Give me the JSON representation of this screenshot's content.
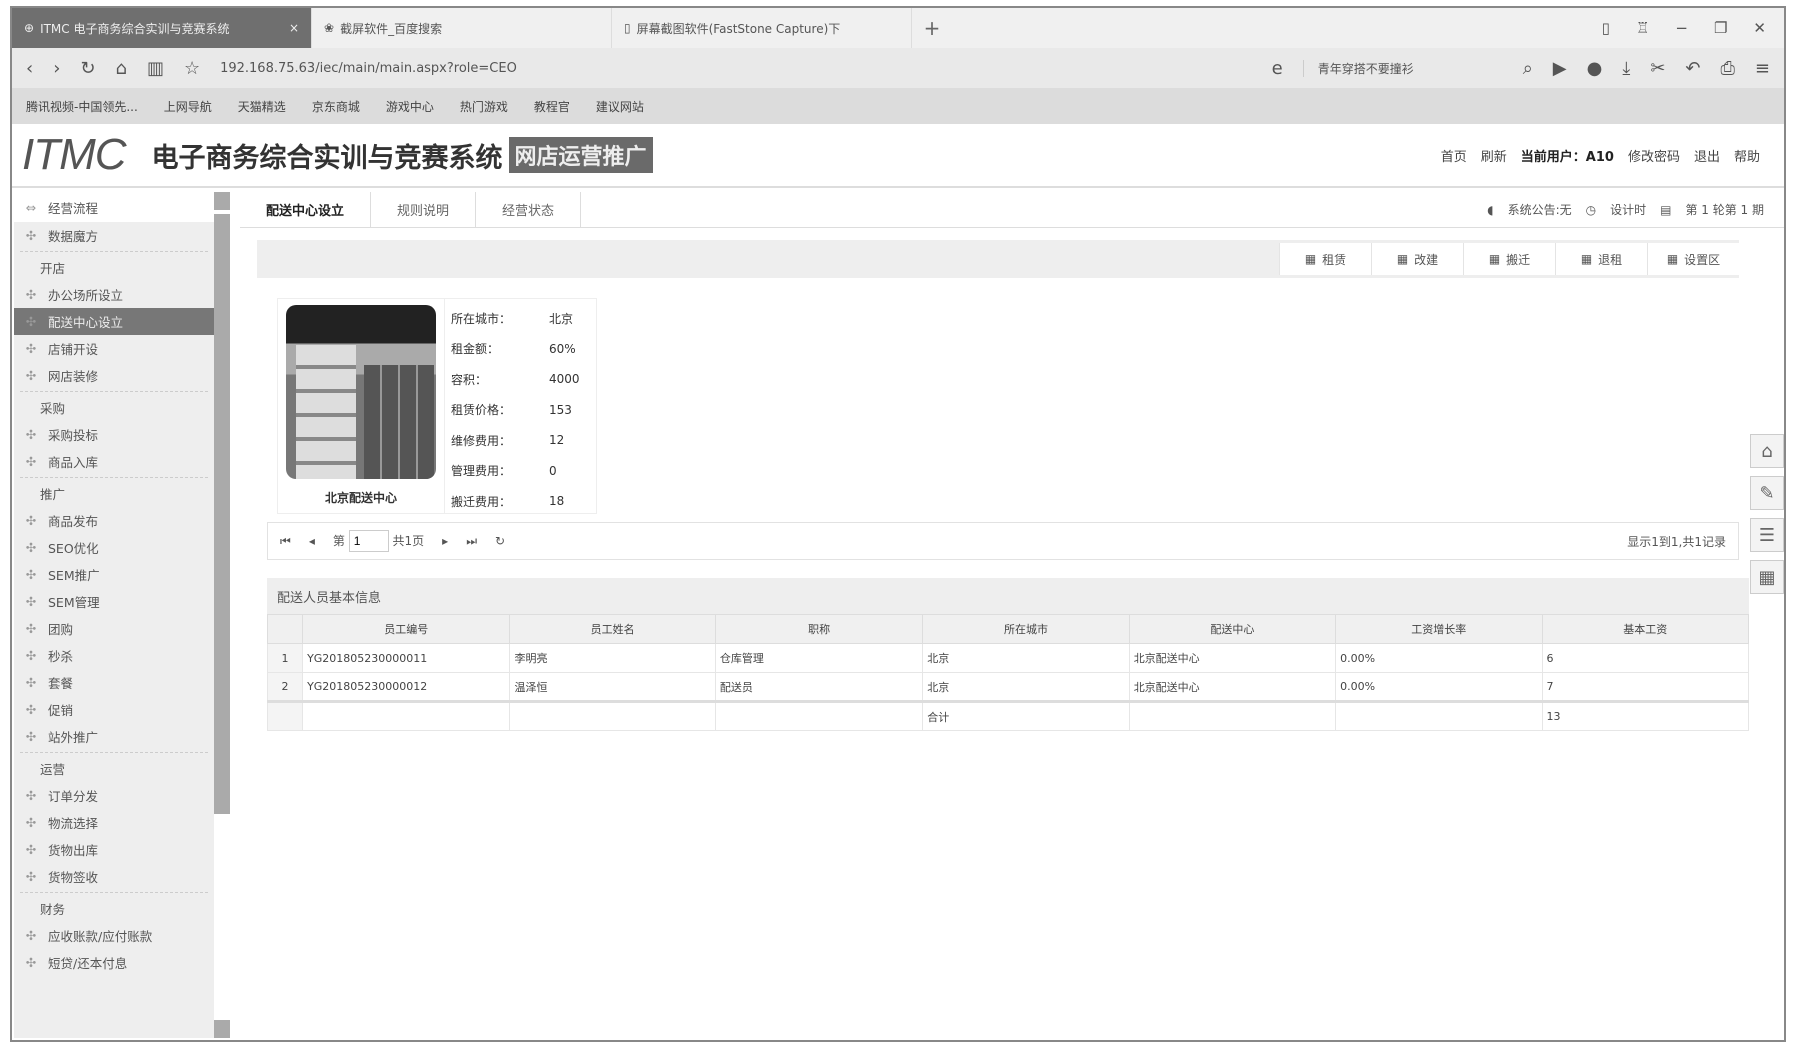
{
  "browser": {
    "tabs": [
      {
        "label": "ITMC 电子商务综合实训与竞赛系统",
        "active": true
      },
      {
        "label": "截屏软件_百度搜索"
      },
      {
        "label": "屏幕截图软件(FastStone Capture)下"
      }
    ],
    "url": "192.168.75.63/iec/main/main.aspx?role=CEO",
    "search": "青年穿搭不要撞衫",
    "bookmarks": [
      "腾讯视频-中国领先...",
      "上网导航",
      "天猫精选",
      "京东商城",
      "游戏中心",
      "热门游戏",
      "教程官",
      "建议网站"
    ]
  },
  "app": {
    "logo": "ITMC",
    "title": "电子商务综合实训与竞赛系统",
    "badge": "网店运营推广",
    "links": {
      "home": "首页",
      "refresh": "刷新",
      "user": "当前用户：A10",
      "change_password": "修改密码",
      "logout": "退出",
      "help": "帮助"
    }
  },
  "sidebar": {
    "header": "经营流程",
    "items": [
      {
        "label": "数据魔方",
        "type": "item"
      },
      {
        "type": "sep"
      },
      {
        "label": "开店",
        "type": "group"
      },
      {
        "label": "办公场所设立",
        "type": "item"
      },
      {
        "label": "配送中心设立",
        "type": "item",
        "selected": true
      },
      {
        "label": "店铺开设",
        "type": "item"
      },
      {
        "label": "网店装修",
        "type": "item"
      },
      {
        "type": "sep"
      },
      {
        "label": "采购",
        "type": "group"
      },
      {
        "label": "采购投标",
        "type": "item"
      },
      {
        "label": "商品入库",
        "type": "item"
      },
      {
        "type": "sep"
      },
      {
        "label": "推广",
        "type": "group"
      },
      {
        "label": "商品发布",
        "type": "item"
      },
      {
        "label": "SEO优化",
        "type": "item"
      },
      {
        "label": "SEM推广",
        "type": "item"
      },
      {
        "label": "SEM管理",
        "type": "item"
      },
      {
        "label": "团购",
        "type": "item"
      },
      {
        "label": "秒杀",
        "type": "item"
      },
      {
        "label": "套餐",
        "type": "item"
      },
      {
        "label": "促销",
        "type": "item"
      },
      {
        "label": "站外推广",
        "type": "item"
      },
      {
        "type": "sep"
      },
      {
        "label": "运营",
        "type": "group"
      },
      {
        "label": "订单分发",
        "type": "item"
      },
      {
        "label": "物流选择",
        "type": "item"
      },
      {
        "label": "货物出库",
        "type": "item"
      },
      {
        "label": "货物签收",
        "type": "item"
      },
      {
        "type": "sep"
      },
      {
        "label": "财务",
        "type": "group"
      },
      {
        "label": "应收账款/应付账款",
        "type": "item"
      },
      {
        "label": "短贷/还本付息",
        "type": "item"
      }
    ]
  },
  "tabs": [
    "配送中心设立",
    "规则说明",
    "经营状态"
  ],
  "status": {
    "notice": "系统公告:无",
    "timer": "设计时",
    "period": "第 1 轮第 1 期"
  },
  "toolbar": [
    "租赁",
    "改建",
    "搬迁",
    "退租",
    "设置区"
  ],
  "center": {
    "caption": "北京配送中心",
    "props": [
      [
        "所在城市：",
        "北京"
      ],
      [
        "租金额：",
        "60%"
      ],
      [
        "容积：",
        "4000"
      ],
      [
        "租赁价格：",
        "153"
      ],
      [
        "维修费用：",
        "12"
      ],
      [
        "管理费用：",
        "0"
      ],
      [
        "搬迁费用：",
        "18"
      ]
    ]
  },
  "pager": {
    "page_label": "第",
    "page": "1",
    "total": "共1页",
    "info": "显示1到1,共1记录"
  },
  "staff": {
    "title": "配送人员基本信息",
    "columns": [
      "员工编号",
      "员工姓名",
      "职称",
      "所在城市",
      "配送中心",
      "工资增长率",
      "基本工资"
    ],
    "rows": [
      [
        "1",
        "YG201805230000011",
        "李明亮",
        "仓库管理",
        "北京",
        "北京配送中心",
        "0.00%",
        "6"
      ],
      [
        "2",
        "YG201805230000012",
        "温泽恒",
        "配送员",
        "北京",
        "北京配送中心",
        "0.00%",
        "7"
      ]
    ],
    "total_label": "合计",
    "total": "13"
  }
}
